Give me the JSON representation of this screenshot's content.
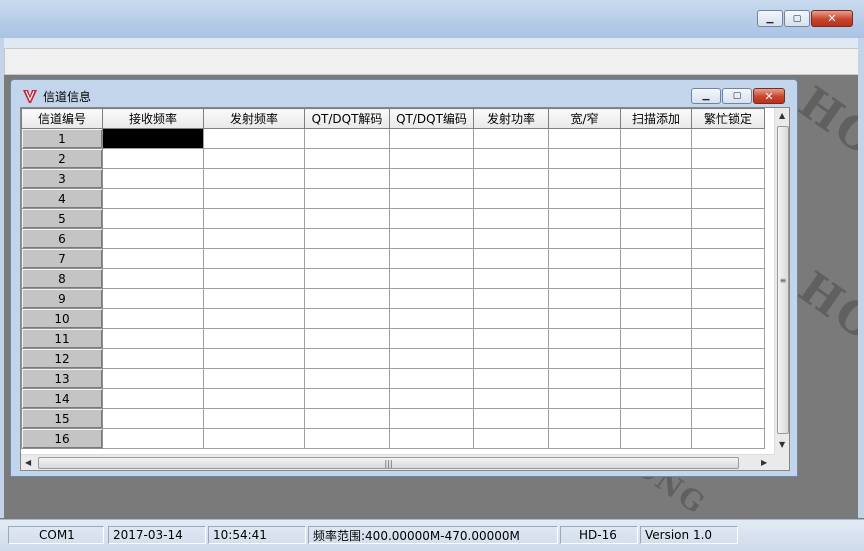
{
  "outer_window": {
    "min_icon": "minimize-icon",
    "max_icon": "maximize-icon",
    "close_icon": "close-icon"
  },
  "watermark": [
    "HONG",
    "HONG",
    "HONG"
  ],
  "child_window": {
    "title": "信道信息",
    "logo_icon": "app-logo-icon"
  },
  "table": {
    "columns": [
      "信道编号",
      "接收频率",
      "发射频率",
      "QT/DQT解码",
      "QT/DQT编码",
      "发射功率",
      "宽/窄",
      "扫描添加",
      "繁忙锁定"
    ],
    "rows": [
      "1",
      "2",
      "3",
      "4",
      "5",
      "6",
      "7",
      "8",
      "9",
      "10",
      "11",
      "12",
      "13",
      "14",
      "15",
      "16"
    ],
    "selected_row": 0,
    "selected_col": 1
  },
  "statusbar": {
    "port": "COM1",
    "date": "2017-03-14",
    "time": "10:54:41",
    "freq_range": "频率范围:400.00000M-470.00000M",
    "model": "HD-16",
    "version": "Version 1.0"
  }
}
